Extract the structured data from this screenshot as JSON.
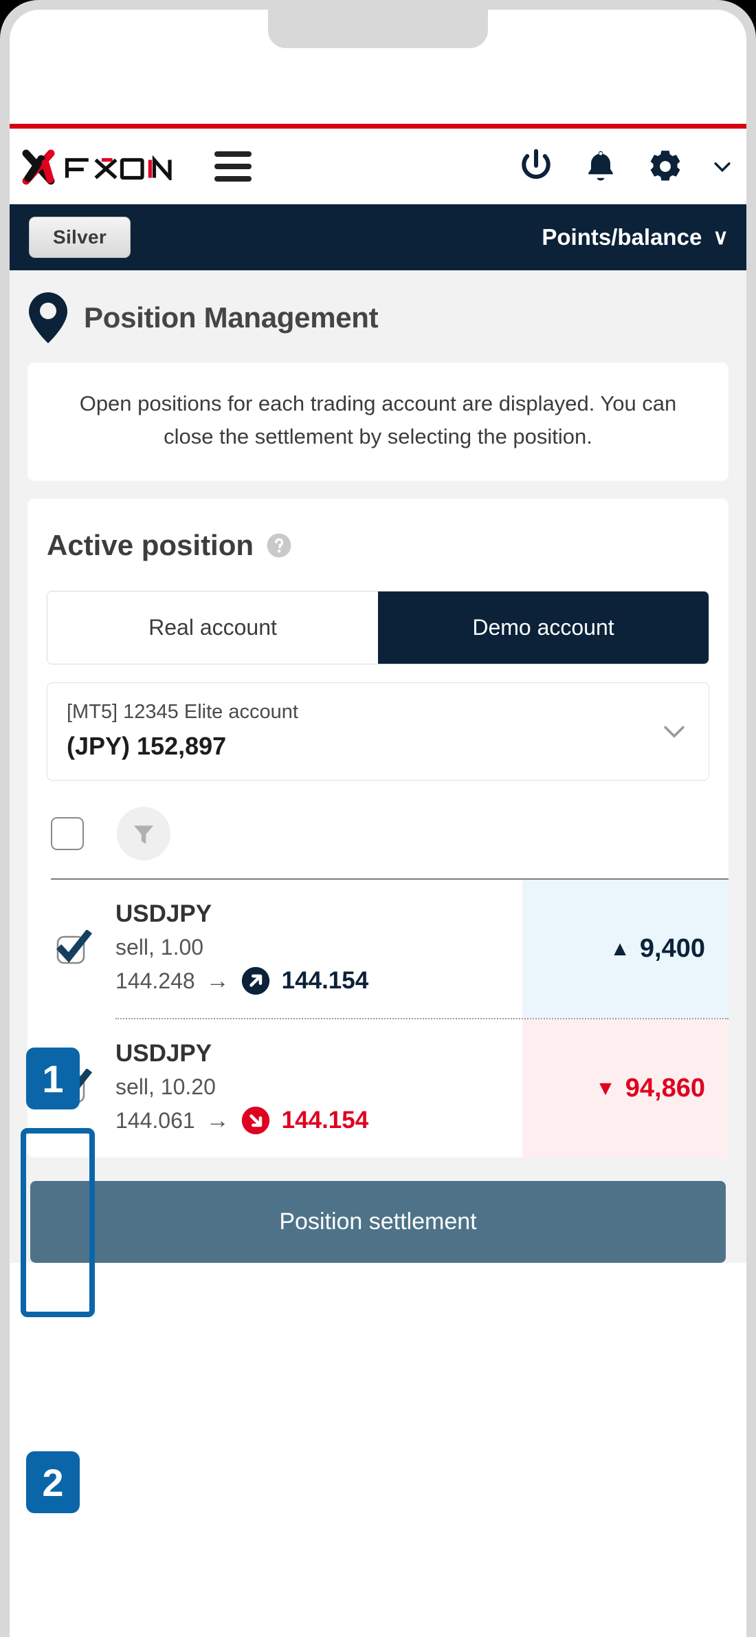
{
  "header": {
    "logo_text": "FXON",
    "menu_icon": "hamburger-icon",
    "power_icon": "power-icon",
    "bell_icon": "bell-icon",
    "gear_icon": "gear-icon",
    "chevron_icon": "chevron-down-icon"
  },
  "account_bar": {
    "rank": "Silver",
    "points_label": "Points/balance",
    "chevron": "∨"
  },
  "page": {
    "title": "Position Management",
    "pin_icon": "map-pin-icon",
    "description": "Open positions for each trading account are displayed. You can close the settlement by selecting the position."
  },
  "panel": {
    "title": "Active position",
    "help_icon": "help-circle-icon",
    "tabs": [
      {
        "label": "Real account",
        "active": false
      },
      {
        "label": "Demo account",
        "active": true
      }
    ],
    "account_select": {
      "name": "[MT5] 12345 Elite account",
      "balance": "(JPY) 152,897",
      "chevron_icon": "chevron-down-icon"
    },
    "toolbar": {
      "select_all_checkbox": "unchecked",
      "filter_icon": "filter-funnel-icon"
    },
    "positions": [
      {
        "checked": true,
        "symbol": "USDJPY",
        "side": "sell,  1.00",
        "open_price": "144.248",
        "arrow": "→",
        "current_price": "144.154",
        "direction": "up",
        "direction_icon": "arrow-up-right-circle-icon",
        "pl_triangle": "▲",
        "pl_value": "9,400"
      },
      {
        "checked": true,
        "symbol": "USDJPY",
        "side": "sell,  10.20",
        "open_price": "144.061",
        "arrow": "→",
        "current_price": "144.154",
        "direction": "down",
        "direction_icon": "arrow-down-right-circle-icon",
        "pl_triangle": "▼",
        "pl_value": "94,860"
      }
    ]
  },
  "footer": {
    "settlement_label": "Position settlement"
  },
  "annotations": {
    "step1": "1",
    "step2": "2"
  },
  "colors": {
    "brand_red": "#d8000f",
    "navy": "#0b2239",
    "annotation_blue": "#0a66a8",
    "profit_blue": "#0b2239",
    "loss_red": "#e00020",
    "button_slate": "#4e7389"
  }
}
